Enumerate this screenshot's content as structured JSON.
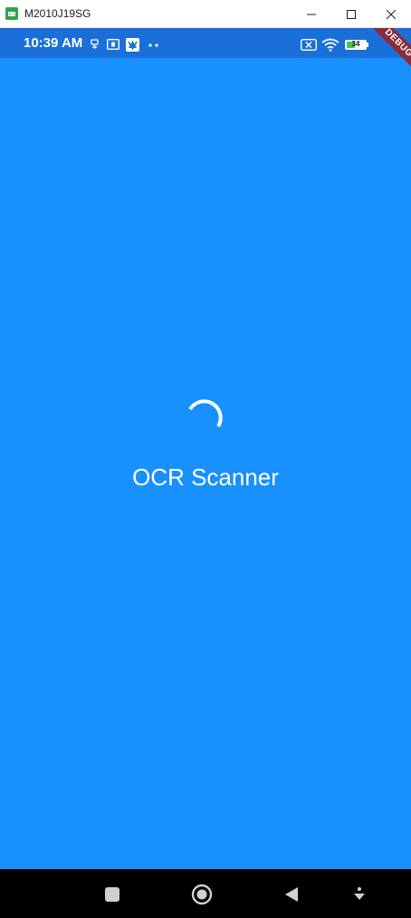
{
  "window": {
    "title": "M2010J19SG",
    "app_icon": "android-emulator-icon",
    "controls": [
      "minimize-icon",
      "maximize-icon",
      "close-icon"
    ]
  },
  "status_bar": {
    "time": "10:39 AM",
    "icons": [
      "usb-icon",
      "sim-card-icon",
      "app-notification-icon",
      "more-dots-icon",
      "no-sim-icon",
      "wifi-icon"
    ],
    "battery": "34",
    "debug_banner": "DEBUG"
  },
  "splash": {
    "title": "OCR Scanner"
  },
  "navigation_bar": {
    "buttons": [
      "recents-button",
      "home-button",
      "back-button",
      "accessibility-button"
    ]
  },
  "colors": {
    "screen_background": "#1890ff",
    "status_bar": "#1a6fd8",
    "nav_bar": "#000000",
    "debug_ribbon": "#8b2a3a",
    "battery_fill": "#3cc94a"
  }
}
